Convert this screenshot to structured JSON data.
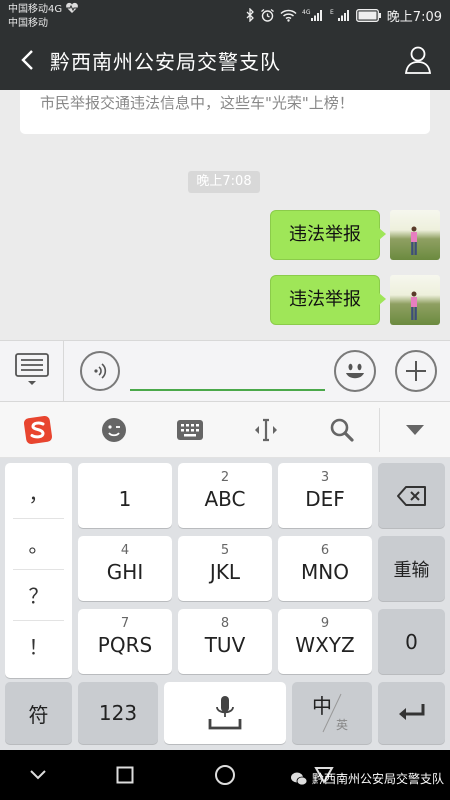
{
  "status_bar": {
    "carrier_line1": "中国移动4G",
    "carrier_line2": "中国移动",
    "time": "晚上7:09"
  },
  "header": {
    "title": "黔西南州公安局交警支队"
  },
  "chat": {
    "article_title": "市民举报交通违法信息中，这些车\"光荣\"上榜！",
    "timestamp": "晚上7:08",
    "messages": [
      {
        "text": "违法举报",
        "sender": "me"
      },
      {
        "text": "违法举报",
        "sender": "me"
      }
    ]
  },
  "input_bar": {
    "text_value": ""
  },
  "keyboard": {
    "symbols": [
      "，",
      "。",
      "？",
      "！"
    ],
    "rows": [
      [
        {
          "num": "",
          "label": "1"
        },
        {
          "num": "2",
          "label": "ABC"
        },
        {
          "num": "3",
          "label": "DEF"
        }
      ],
      [
        {
          "num": "4",
          "label": "GHI"
        },
        {
          "num": "5",
          "label": "JKL"
        },
        {
          "num": "6",
          "label": "MNO"
        }
      ],
      [
        {
          "num": "7",
          "label": "PQRS"
        },
        {
          "num": "8",
          "label": "TUV"
        },
        {
          "num": "9",
          "label": "WXYZ"
        }
      ]
    ],
    "reenter": "重输",
    "zero": "0",
    "symbol_key": "符",
    "num_key": "123",
    "lang_zh": "中",
    "lang_en": "英"
  },
  "watermark": "黔西南州公安局交警支队",
  "colors": {
    "header_bg": "#2e3132",
    "bubble_green": "#9fe658",
    "input_underline": "#4aa84a",
    "sogou_red": "#e8452f"
  }
}
